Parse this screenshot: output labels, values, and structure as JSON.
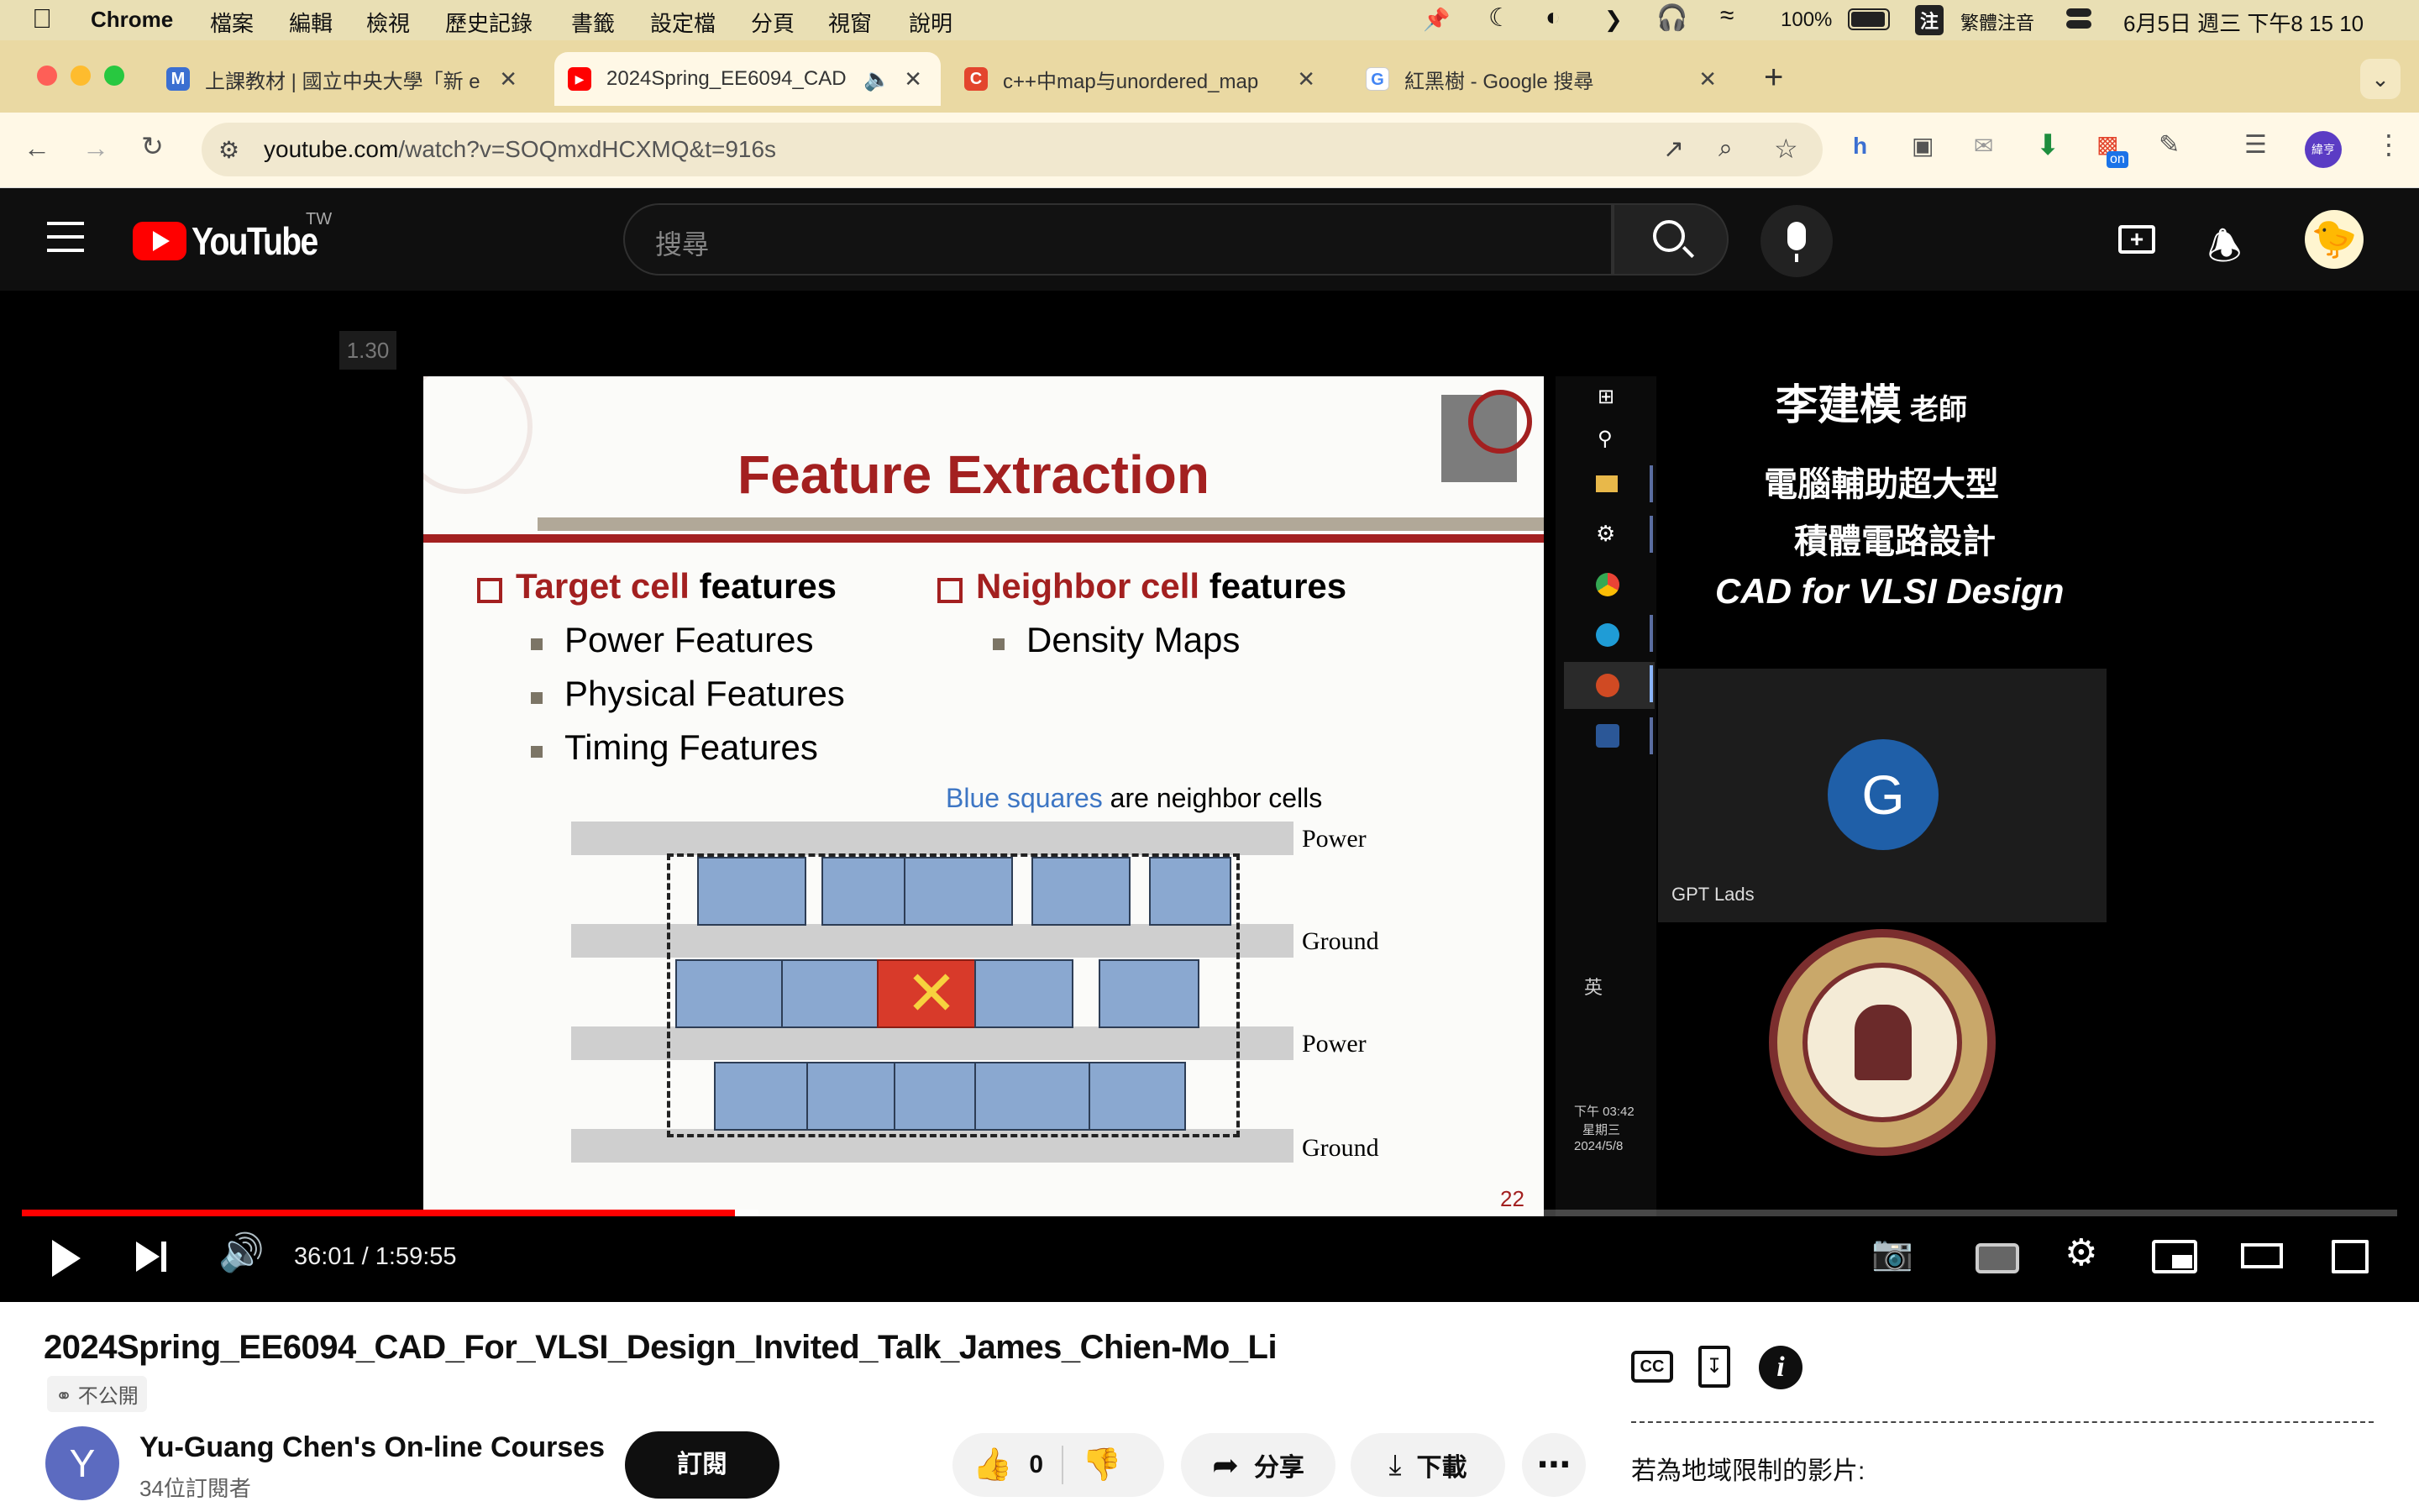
{
  "macos_menubar": {
    "app_name": "Chrome",
    "menus": [
      "檔案",
      "編輯",
      "檢視",
      "歷史記錄",
      "書籤",
      "設定檔",
      "分頁",
      "視窗",
      "說明"
    ],
    "battery": "100%",
    "input_method_badge": "注",
    "input_method": "繁體注音",
    "clock": "6月5日 週三 下午8 15 10"
  },
  "tabs": [
    {
      "title": "上課教材 | 國立中央大學「新 e",
      "favicon": "M",
      "favicon_color": "#3b6fd1"
    },
    {
      "title": "2024Spring_EE6094_CAD",
      "favicon": "▶",
      "favicon_color": "#ff0000",
      "active": true
    },
    {
      "title": "c++中map与unordered_map",
      "favicon": "C",
      "favicon_color": "#e3452d"
    },
    {
      "title": "紅黑樹 - Google 搜尋",
      "favicon": "G",
      "favicon_color": "#4285f4"
    }
  ],
  "omnibox": {
    "url_host": "youtube.com",
    "url_path": "/watch?v=SOQmxdHCXMQ&t=916s"
  },
  "extensions": {
    "profile_badge": "緯亨",
    "ext_badge": "on"
  },
  "youtube": {
    "logo_text": "YouTube",
    "country": "TW",
    "search_placeholder": "搜尋",
    "brand_color": "#ff0000"
  },
  "video": {
    "playback_rate_overlay": "1.30",
    "slide": {
      "title": "Feature Extraction",
      "left_heading_color": "Target cell",
      "left_heading_rest": " features",
      "left_items": [
        "Power Features",
        "Physical Features",
        "Timing Features"
      ],
      "right_heading_color": "Neighbor cell",
      "right_heading_rest": " features",
      "right_items": [
        "Density Maps"
      ],
      "caption_blue": "Blue squares",
      "caption_rest": " are neighbor cells",
      "rail_labels": [
        "Power",
        "Ground",
        "Power",
        "Ground"
      ],
      "page_number": "22",
      "title_color": "#a32020"
    },
    "taskbar": {
      "lang": "英",
      "time": "下午 03:42",
      "day": "星期三",
      "date": "2024/5/8"
    },
    "side_panel": {
      "teacher_name": "李建模",
      "teacher_suffix": "老師",
      "course_line1": "電腦輔助超大型",
      "course_line2": "積體電路設計",
      "course_en": "CAD for VLSI Design",
      "participant_initial": "G",
      "participant_name": "GPT Lads"
    },
    "progress": 0.3001,
    "buffered": 0.31,
    "time_current": "36:01",
    "time_separator": " / ",
    "time_total": "1:59:55"
  },
  "meta": {
    "title": "2024Spring_EE6094_CAD_For_VLSI_Design_Invited_Talk_James_Chien-Mo_Li",
    "visibility": "不公開",
    "channel_initial": "Y",
    "channel_name": "Yu-Guang Chen's On-line Courses",
    "subscribers": "34位訂閱者",
    "subscribe_label": "訂閱",
    "like_count": "0",
    "share_label": "分享",
    "download_label": "下載",
    "region_note": "若為地域限制的影片:"
  }
}
